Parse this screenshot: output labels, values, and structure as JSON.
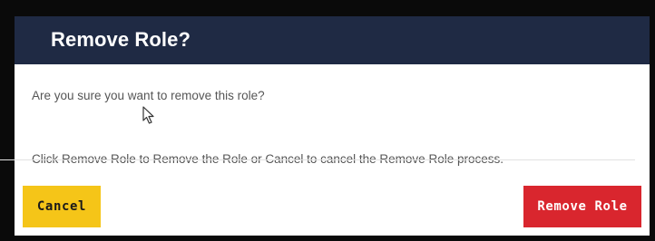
{
  "dialog": {
    "title": "Remove Role?",
    "body_line_1": "Are you sure you want to remove this role?",
    "body_line_2": "Click Remove Role to Remove the Role or Cancel to cancel the Remove Role process.",
    "cancel_label": "Cancel",
    "remove_label": "Remove Role"
  },
  "colors": {
    "header_bg": "#1f2a44",
    "cancel_bg": "#f5c518",
    "remove_bg": "#d9262e"
  },
  "icons": {
    "cursor": "mouse-pointer-icon"
  }
}
